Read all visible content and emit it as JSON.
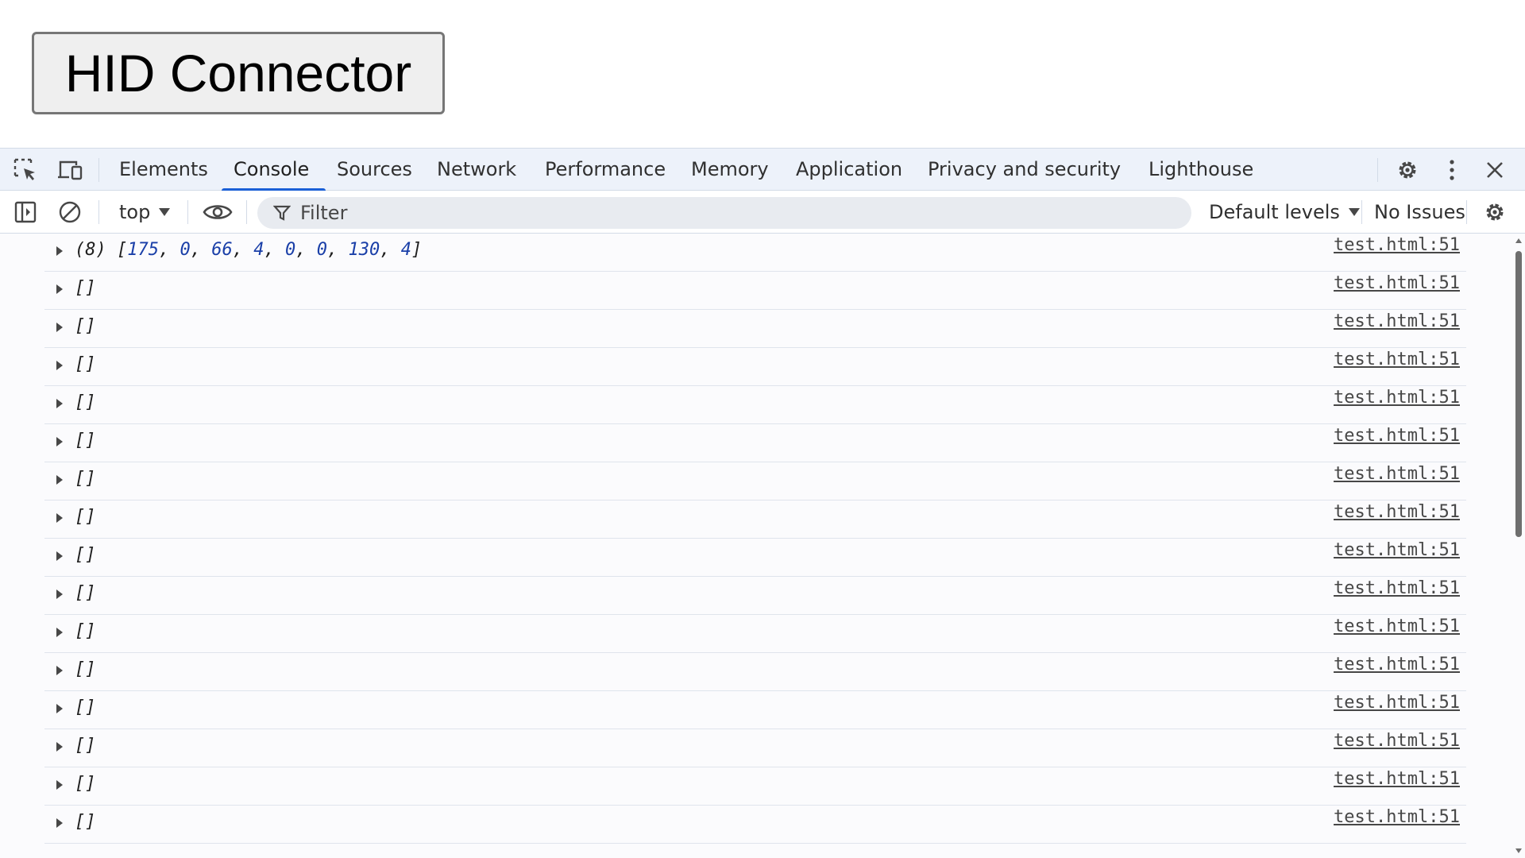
{
  "page": {
    "button_label": "HID Connector"
  },
  "devtools": {
    "tabs": [
      {
        "label": "Elements"
      },
      {
        "label": "Console"
      },
      {
        "label": "Sources"
      },
      {
        "label": "Network"
      },
      {
        "label": "Performance"
      },
      {
        "label": "Memory"
      },
      {
        "label": "Application"
      },
      {
        "label": "Privacy and security"
      },
      {
        "label": "Lighthouse"
      }
    ],
    "active_tab": "Console",
    "toolbar": {
      "context": "top",
      "filter_placeholder": "Filter",
      "levels": "Default levels",
      "issues": "No Issues"
    },
    "console": {
      "first_entry": {
        "count": "(8)",
        "values": [
          "175",
          "0",
          "66",
          "4",
          "0",
          "0",
          "130",
          "4"
        ],
        "source": "test.html:51"
      },
      "entries": [
        {
          "message": "[]",
          "source": "test.html:51"
        },
        {
          "message": "[]",
          "source": "test.html:51"
        },
        {
          "message": "[]",
          "source": "test.html:51"
        },
        {
          "message": "[]",
          "source": "test.html:51"
        },
        {
          "message": "[]",
          "source": "test.html:51"
        },
        {
          "message": "[]",
          "source": "test.html:51"
        },
        {
          "message": "[]",
          "source": "test.html:51"
        },
        {
          "message": "[]",
          "source": "test.html:51"
        },
        {
          "message": "[]",
          "source": "test.html:51"
        },
        {
          "message": "[]",
          "source": "test.html:51"
        },
        {
          "message": "[]",
          "source": "test.html:51"
        },
        {
          "message": "[]",
          "source": "test.html:51"
        },
        {
          "message": "[]",
          "source": "test.html:51"
        },
        {
          "message": "[]",
          "source": "test.html:51"
        },
        {
          "message": "[]",
          "source": "test.html:51"
        }
      ]
    },
    "colors": {
      "accent": "#1a5fd6",
      "tabbar_bg": "#edf2fa",
      "number_blue": "#1a3fa8"
    }
  }
}
